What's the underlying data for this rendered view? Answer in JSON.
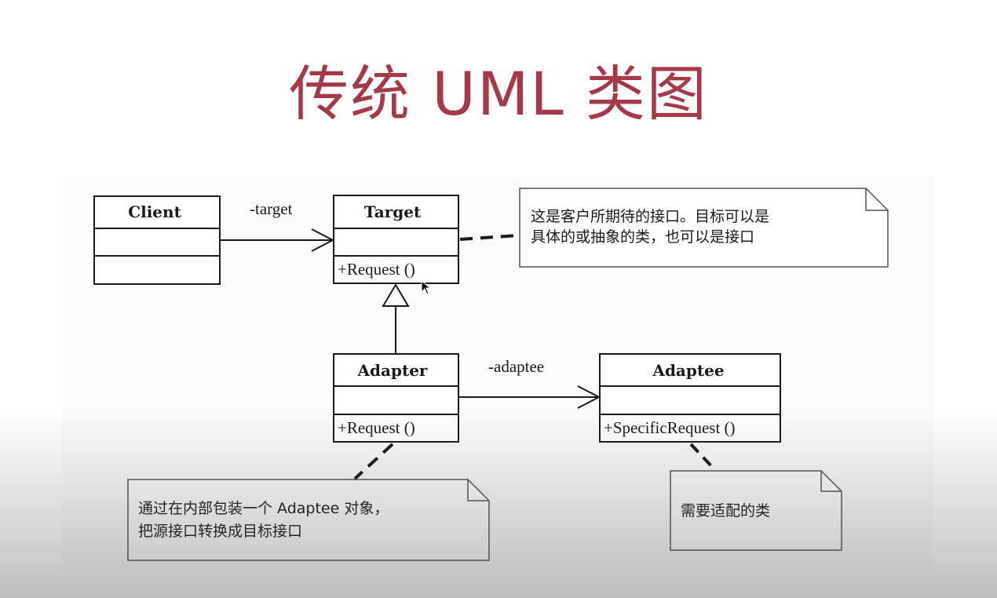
{
  "title": "传统 UML 类图",
  "classes": {
    "client": {
      "name": "Client"
    },
    "target": {
      "name": "Target",
      "method": "+Request ()"
    },
    "adapter": {
      "name": "Adapter",
      "method": "+Request ()"
    },
    "adaptee": {
      "name": "Adaptee",
      "method": "+SpecificRequest ()"
    }
  },
  "associations": {
    "client_target": "-target",
    "adapter_adaptee": "-adaptee"
  },
  "notes": {
    "target_note": [
      "这是客户所期待的接口。目标可以是",
      "具体的或抽象的类，也可以是接口"
    ],
    "adapter_note": [
      "通过在内部包装一个 Adaptee 对象，",
      "把源接口转换成目标接口"
    ],
    "adaptee_note": [
      "需要适配的类"
    ]
  },
  "colors": {
    "title": "#a5394a",
    "line": "#1a1a1a"
  }
}
